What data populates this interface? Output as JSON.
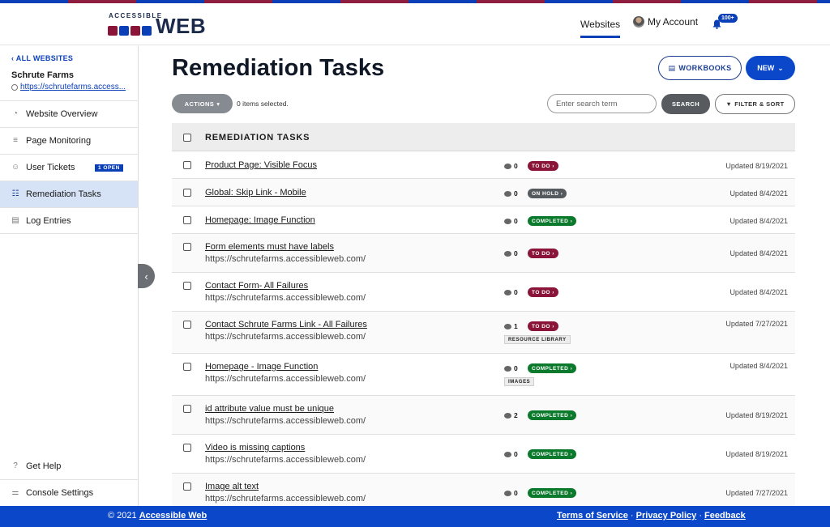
{
  "header": {
    "logo_small": "ACCESSIBLE",
    "logo_text": "WEB",
    "nav_websites": "Websites",
    "nav_account": "My Account",
    "notifications_badge": "100+"
  },
  "sidebar": {
    "back_label": "ALL WEBSITES",
    "site_name": "Schrute Farms",
    "site_url": "https://schrutefarms.access...",
    "items": [
      {
        "label": "Website Overview",
        "icon": "speedometer-icon"
      },
      {
        "label": "Page Monitoring",
        "icon": "list-tree-icon"
      },
      {
        "label": "User Tickets",
        "icon": "user-icon",
        "badge": "1 OPEN"
      },
      {
        "label": "Remediation Tasks",
        "icon": "tasks-icon",
        "active": true
      },
      {
        "label": "Log Entries",
        "icon": "document-icon"
      }
    ],
    "bottom_items": [
      {
        "label": "Get Help",
        "icon": "help-icon"
      },
      {
        "label": "Console Settings",
        "icon": "sliders-icon"
      }
    ]
  },
  "main": {
    "title": "Remediation Tasks",
    "workbooks_label": "WORKBOOKS",
    "new_label": "NEW",
    "actions_label": "ACTIONS",
    "selected_text": "0 items selected.",
    "search_placeholder": "Enter search term",
    "search_label": "SEARCH",
    "filter_label": "FILTER & SORT",
    "table_header": "REMEDIATION TASKS",
    "rows": [
      {
        "title": "Product Page: Visible Focus",
        "url": "",
        "comments": "0",
        "status": "TO DO",
        "status_type": "todo",
        "tag": "",
        "updated": "Updated 8/19/2021"
      },
      {
        "title": "Global: Skip Link - Mobile",
        "url": "",
        "comments": "0",
        "status": "ON HOLD",
        "status_type": "onhold",
        "tag": "",
        "updated": "Updated 8/4/2021"
      },
      {
        "title": "Homepage: Image Function",
        "url": "",
        "comments": "0",
        "status": "COMPLETED",
        "status_type": "completed",
        "tag": "",
        "updated": "Updated 8/4/2021"
      },
      {
        "title": "Form elements must have labels",
        "url": "https://schrutefarms.accessibleweb.com/",
        "comments": "0",
        "status": "TO DO",
        "status_type": "todo",
        "tag": "",
        "updated": "Updated 8/4/2021"
      },
      {
        "title": "Contact Form- All Failures",
        "url": "https://schrutefarms.accessibleweb.com/",
        "comments": "0",
        "status": "TO DO",
        "status_type": "todo",
        "tag": "",
        "updated": "Updated 8/4/2021"
      },
      {
        "title": "Contact Schrute Farms Link - All Failures",
        "url": "https://schrutefarms.accessibleweb.com/",
        "comments": "1",
        "status": "TO DO",
        "status_type": "todo",
        "tag": "RESOURCE LIBRARY",
        "updated": "Updated 7/27/2021"
      },
      {
        "title": "Homepage - Image Function",
        "url": "https://schrutefarms.accessibleweb.com/",
        "comments": "0",
        "status": "COMPLETED",
        "status_type": "completed",
        "tag": "IMAGES",
        "updated": "Updated 8/4/2021"
      },
      {
        "title": "id attribute value must be unique",
        "url": "https://schrutefarms.accessibleweb.com/",
        "comments": "2",
        "status": "COMPLETED",
        "status_type": "completed",
        "tag": "",
        "updated": "Updated 8/19/2021"
      },
      {
        "title": "Video is missing captions",
        "url": "https://schrutefarms.accessibleweb.com/",
        "comments": "0",
        "status": "COMPLETED",
        "status_type": "completed",
        "tag": "",
        "updated": "Updated 8/19/2021"
      },
      {
        "title": "Image alt text",
        "url": "https://schrutefarms.accessibleweb.com/",
        "comments": "0",
        "status": "COMPLETED",
        "status_type": "completed",
        "tag": "",
        "updated": "Updated 7/27/2021"
      }
    ]
  },
  "footer": {
    "copyright_prefix": "© 2021",
    "company_link": "Accessible Web",
    "terms": "Terms of Service",
    "privacy": "Privacy Policy",
    "feedback": "Feedback",
    "separator": "·"
  },
  "colors": {
    "brand_blue": "#0b48c9",
    "brand_maroon": "#8a1538",
    "status_completed": "#0c7a2c",
    "status_onhold": "#555a5f",
    "sidebar_active": "#d6e2f6"
  }
}
